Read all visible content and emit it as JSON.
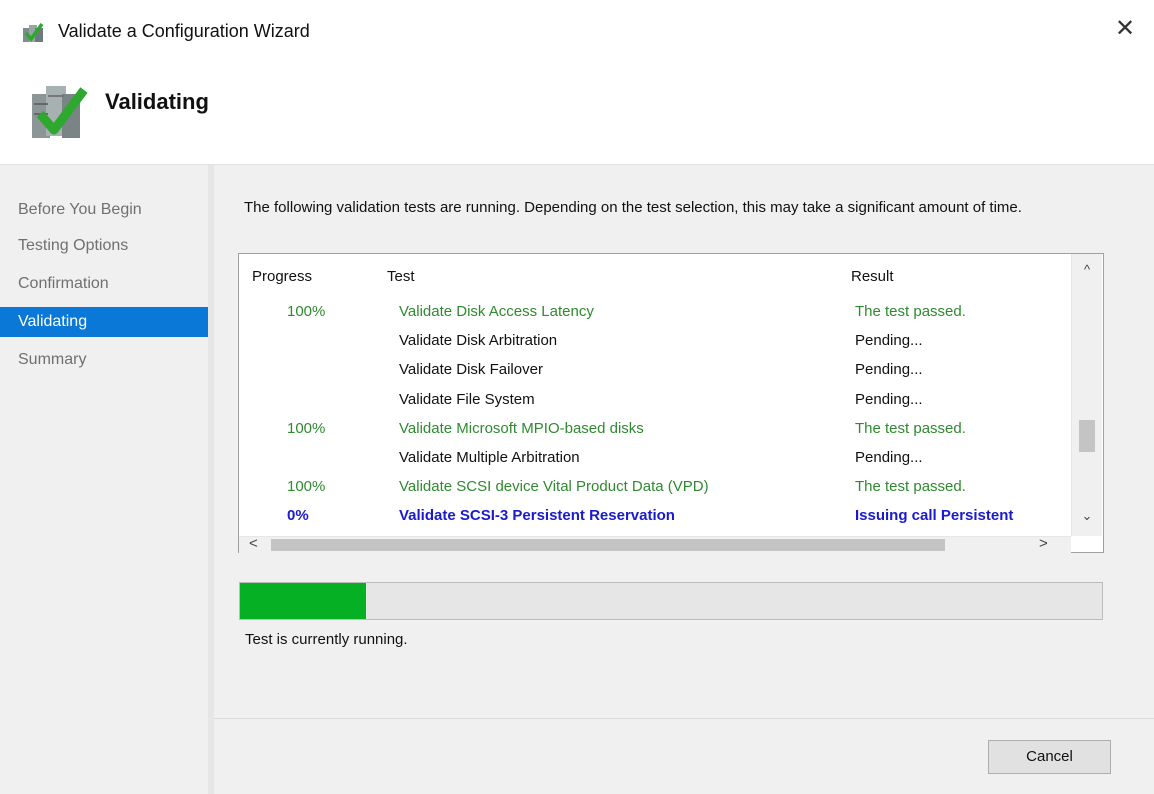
{
  "window": {
    "title": "Validate a Configuration Wizard",
    "close_glyph": "✕",
    "icon": "cluster-wizard-icon"
  },
  "header": {
    "title": "Validating",
    "icon": "validating-checkmark-icon"
  },
  "sidebar": {
    "items": [
      {
        "label": "Before You Begin",
        "active": false
      },
      {
        "label": "Testing Options",
        "active": false
      },
      {
        "label": "Confirmation",
        "active": false
      },
      {
        "label": "Validating",
        "active": true
      },
      {
        "label": "Summary",
        "active": false
      }
    ]
  },
  "main": {
    "intro": "The following validation tests are running. Depending on the test selection, this may take a significant amount of time.",
    "columns": {
      "progress": "Progress",
      "test": "Test",
      "result": "Result"
    },
    "rows": [
      {
        "progress": "100%",
        "test": "Validate Disk Access Latency",
        "result": "The test passed.",
        "state": "done"
      },
      {
        "progress": "",
        "test": "Validate Disk Arbitration",
        "result": "Pending...",
        "state": "pending"
      },
      {
        "progress": "",
        "test": "Validate Disk Failover",
        "result": "Pending...",
        "state": "pending"
      },
      {
        "progress": "",
        "test": "Validate File System",
        "result": "Pending...",
        "state": "pending"
      },
      {
        "progress": "100%",
        "test": "Validate Microsoft MPIO-based disks",
        "result": "The test passed.",
        "state": "done"
      },
      {
        "progress": "",
        "test": "Validate Multiple Arbitration",
        "result": "Pending...",
        "state": "pending"
      },
      {
        "progress": "100%",
        "test": "Validate SCSI device Vital Product Data (VPD)",
        "result": "The test passed.",
        "state": "done"
      },
      {
        "progress": "0%",
        "test": "Validate SCSI-3 Persistent Reservation",
        "result": "Issuing call Persistent",
        "state": "running"
      }
    ],
    "scroll": {
      "up": "^",
      "down": "⌄",
      "left": "<",
      "right": ">"
    },
    "overall_progress_fraction": 0.146,
    "status": "Test is currently running.",
    "cancel_label": "Cancel"
  },
  "colors": {
    "accent": "#0a78d7",
    "passed": "#2f8a2f",
    "running": "#1a1acf",
    "progress_fill": "#06b025"
  }
}
